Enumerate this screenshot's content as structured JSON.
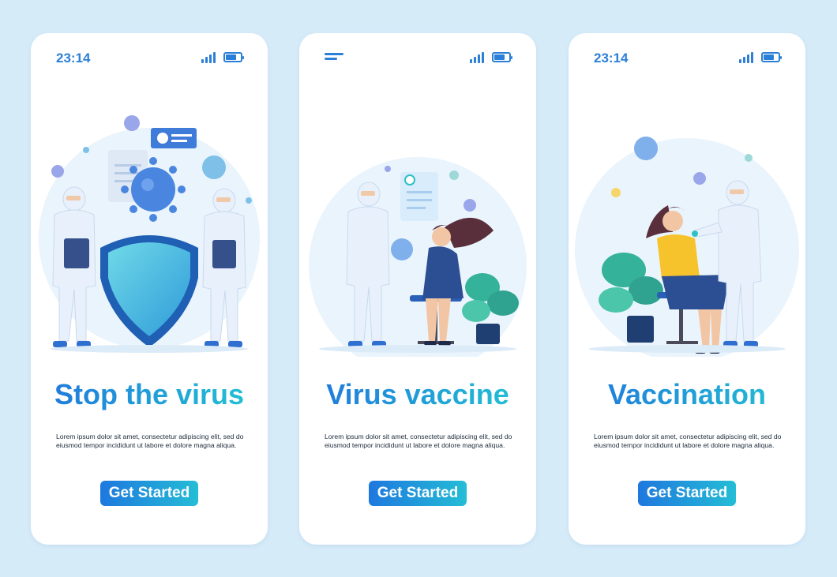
{
  "screens": [
    {
      "status": {
        "time": "23:14",
        "left_icon": "clock"
      },
      "illustration": "doctors-with-shield-icon",
      "title": "Stop the virus",
      "description": "Lorem ipsum dolor sit amet, consectetur adipiscing elit, sed do eiusmod tempor incididunt ut labore et dolore magna aliqua.",
      "button_label": "Get Started"
    },
    {
      "status": {
        "time": "",
        "left_icon": "menu-icon"
      },
      "illustration": "doctor-and-patient-icon",
      "title": "Virus vaccine",
      "description": "Lorem ipsum dolor sit amet, consectetur adipiscing elit, sed do eiusmod tempor incididunt ut labore et dolore magna aliqua.",
      "button_label": "Get Started"
    },
    {
      "status": {
        "time": "23:14",
        "left_icon": "clock"
      },
      "illustration": "vaccination-injection-icon",
      "title": "Vaccination",
      "description": "Lorem ipsum dolor sit amet, consectetur adipiscing elit, sed do eiusmod tempor incididunt ut labore et dolore magna aliqua.",
      "button_label": "Get Started"
    }
  ],
  "status_icons": [
    "signal-icon",
    "battery-icon"
  ],
  "colors": {
    "background": "#d6ebf8",
    "card": "#ffffff",
    "accent_blue": "#2b7fd6",
    "gradient_start": "#1e78de",
    "gradient_end": "#24bdd6",
    "suit": "#e8f1fb",
    "virus": "#5d8fe6",
    "shirt_yellow": "#f6c32c",
    "plant": "#35b39a"
  }
}
